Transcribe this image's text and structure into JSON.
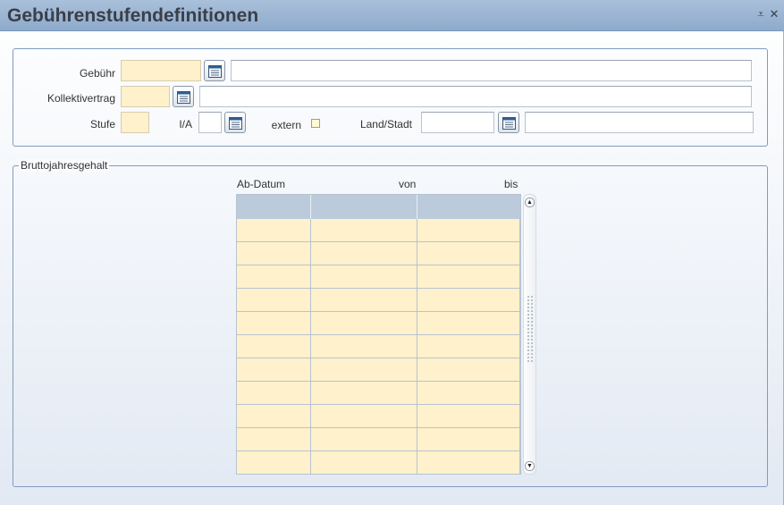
{
  "window": {
    "title": "Gebührenstufendefinitionen",
    "minimize_icon": "minimize-icon",
    "close_icon": "close-icon",
    "minimize_glyph": "⩡",
    "close_glyph": "✕"
  },
  "form": {
    "gebuehr_label": "Gebühr",
    "kollektivvertrag_label": "Kollektivertrag",
    "stufe_label": "Stufe",
    "ia_label": "I/A",
    "extern_label": "extern",
    "land_stadt_label": "Land/Stadt",
    "gebuehr_value": "",
    "gebuehr_desc": "",
    "kollektivvertrag_value": "",
    "kollektivvertrag_desc": "",
    "stufe_value": "",
    "ia_value": "",
    "extern_checked": false,
    "land_stadt_value": "",
    "land_stadt_desc": "",
    "lookup_icon": "calendar-lookup-icon"
  },
  "salary": {
    "legend": "Bruttojahresgehalt",
    "columns": [
      "Ab-Datum",
      "von",
      "bis"
    ],
    "rows": [
      [
        "",
        "",
        ""
      ],
      [
        "",
        "",
        ""
      ],
      [
        "",
        "",
        ""
      ],
      [
        "",
        "",
        ""
      ],
      [
        "",
        "",
        ""
      ],
      [
        "",
        "",
        ""
      ],
      [
        "",
        "",
        ""
      ],
      [
        "",
        "",
        ""
      ],
      [
        "",
        "",
        ""
      ],
      [
        "",
        "",
        ""
      ],
      [
        "",
        "",
        ""
      ]
    ],
    "scroll_up_glyph": "▲",
    "scroll_down_glyph": "▼"
  },
  "colors": {
    "titlebar": "#8eaacb",
    "field_yellow": "#fff1cc",
    "grid_header": "#bccbdb",
    "border": "#7f9cc0"
  }
}
